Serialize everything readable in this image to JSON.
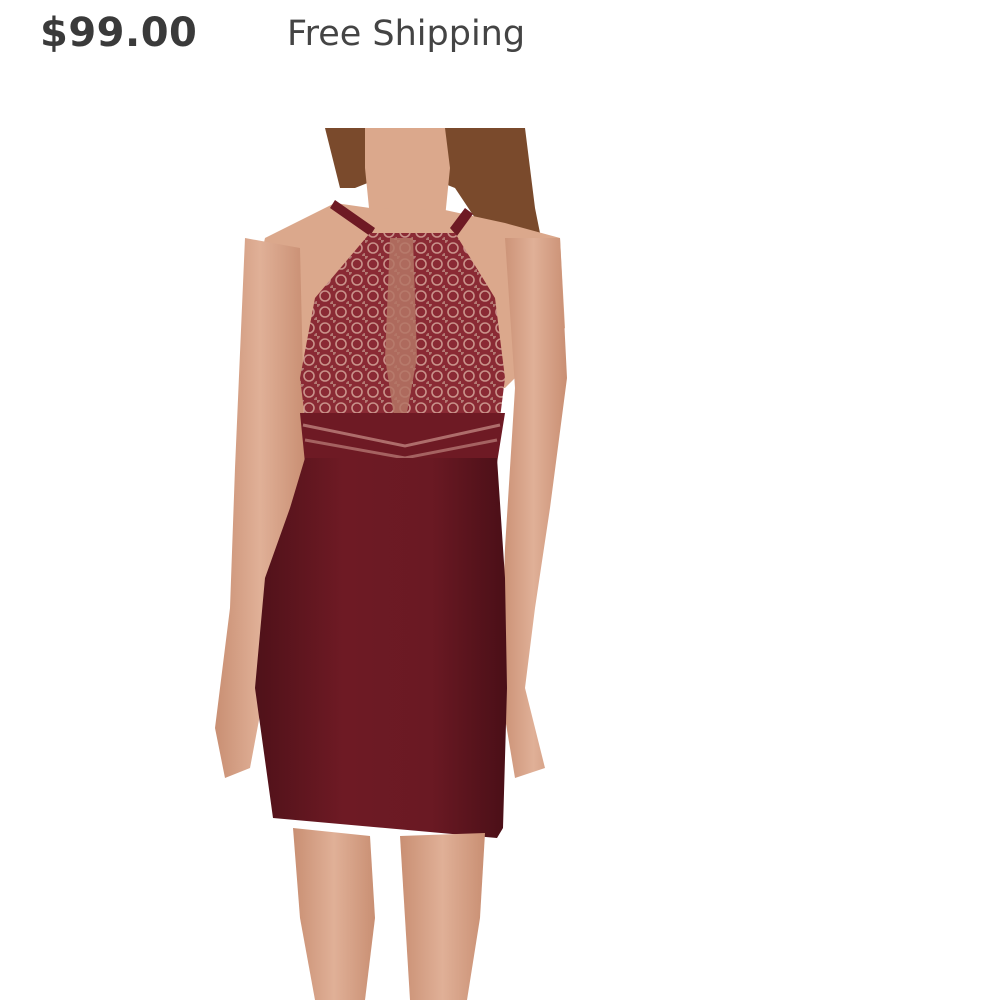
{
  "listing": {
    "price": "$99.00",
    "shipping": "Free Shipping"
  },
  "product_image": {
    "subject": "model wearing burgundy halter mini dress with lace bodice",
    "colors": {
      "dress": "#6e1a24",
      "dress_shadow": "#4f1119",
      "lace_base": "#c9928a",
      "skin": "#dba88c",
      "hair": "#7a4a2c"
    }
  }
}
